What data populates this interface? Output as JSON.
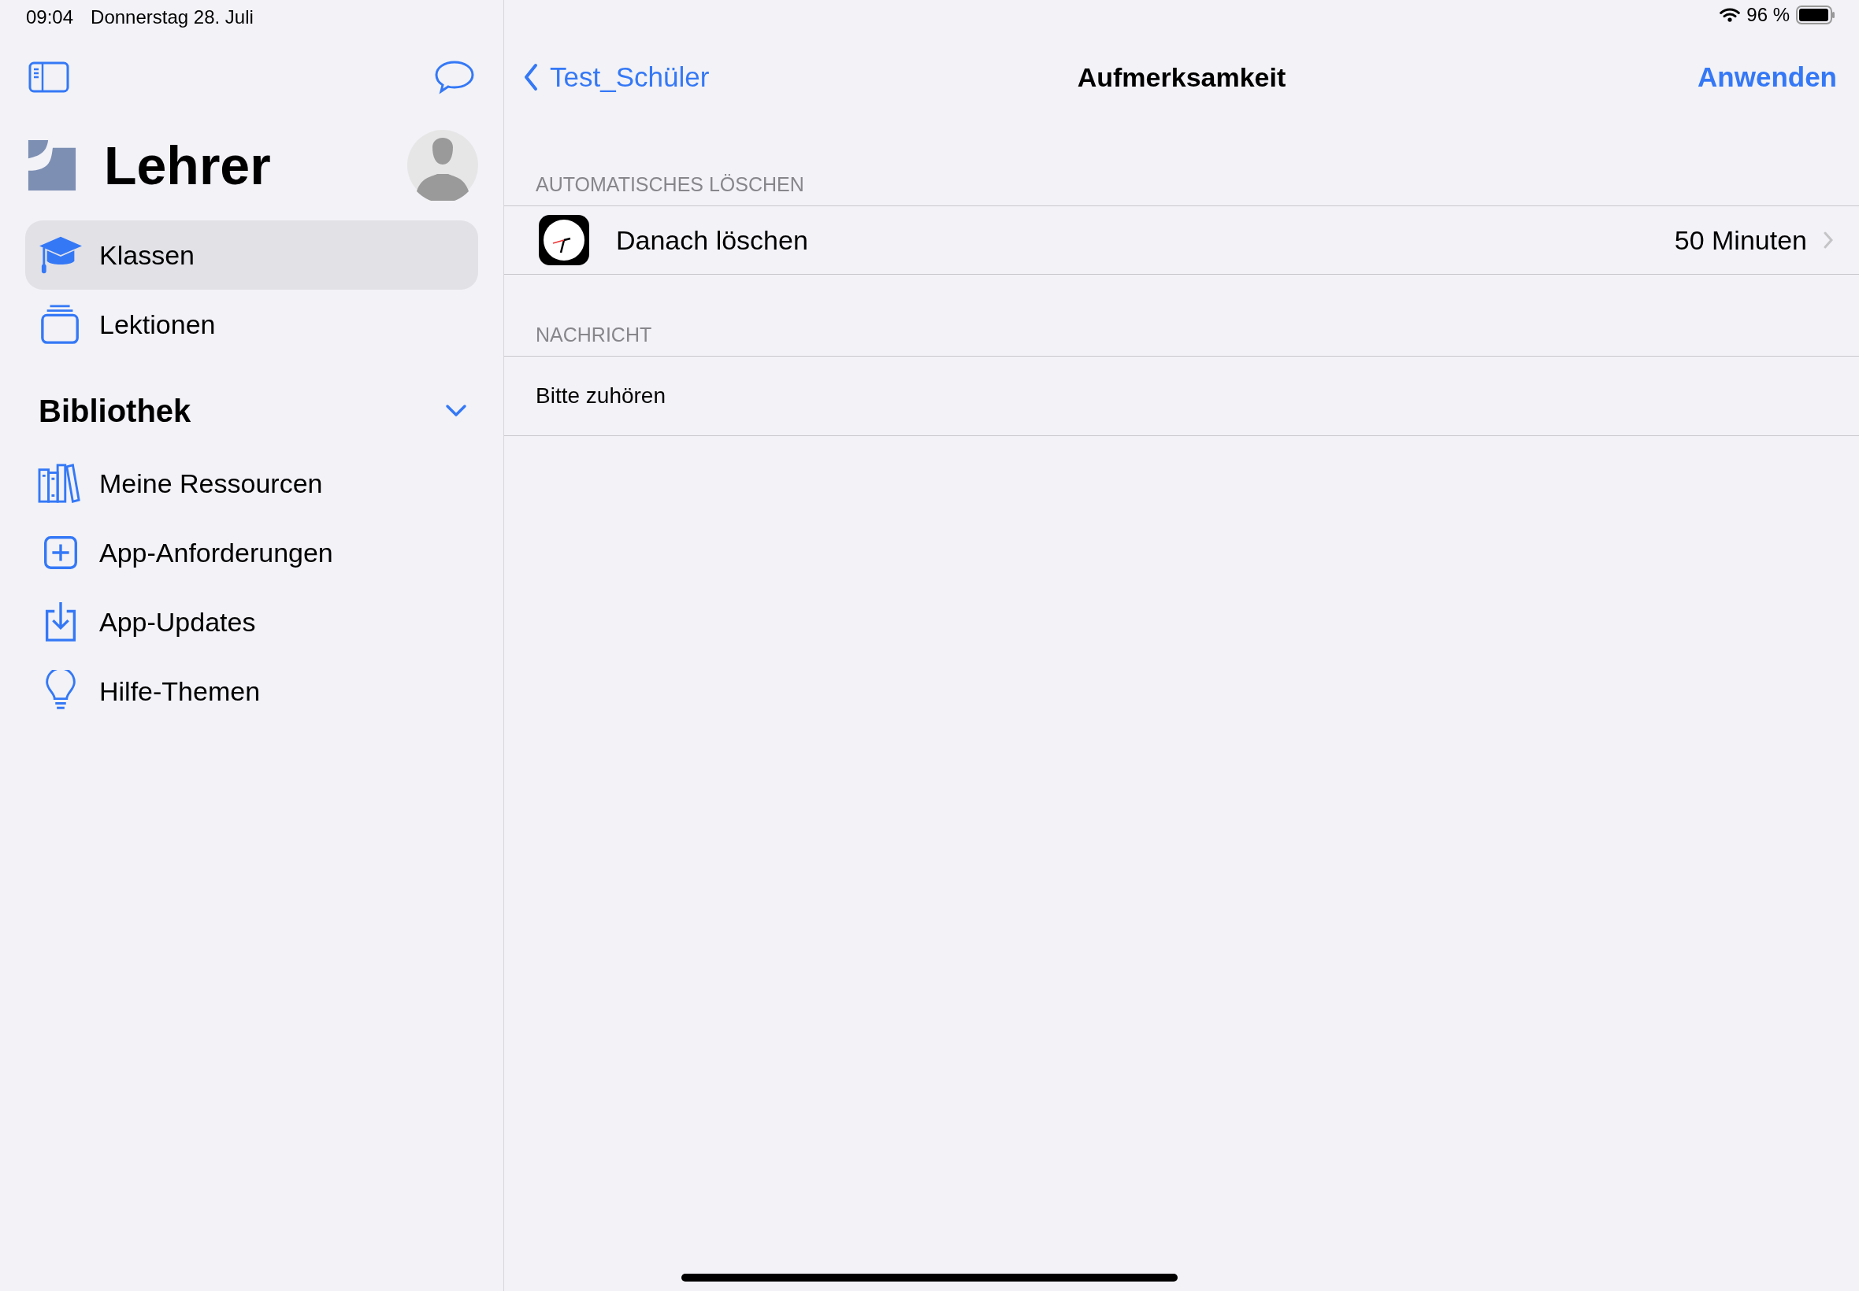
{
  "status_bar": {
    "time": "09:04",
    "date": "Donnerstag 28. Juli",
    "battery": "96 %"
  },
  "sidebar": {
    "title": "Lehrer",
    "items": [
      {
        "label": "Klassen",
        "selected": true
      },
      {
        "label": "Lektionen",
        "selected": false
      }
    ],
    "library": {
      "title": "Bibliothek",
      "expanded": true,
      "items": [
        {
          "label": "Meine Ressourcen",
          "selected": false
        },
        {
          "label": "App-Anforderungen",
          "selected": false
        },
        {
          "label": "App-Updates",
          "selected": false
        },
        {
          "label": "Hilfe-Themen",
          "selected": false
        }
      ]
    }
  },
  "nav": {
    "back": "Test_Schüler",
    "title": "Aufmerksamkeit",
    "action": "Anwenden"
  },
  "sections": [
    {
      "header": "AUTOMATISCHES LÖSCHEN",
      "rows": [
        {
          "kind": "setting",
          "label": "Danach löschen",
          "value": "50 Minuten"
        }
      ]
    },
    {
      "header": "NACHRICHT",
      "rows": [
        {
          "kind": "text",
          "label": "Bitte zuhören"
        }
      ]
    }
  ]
}
